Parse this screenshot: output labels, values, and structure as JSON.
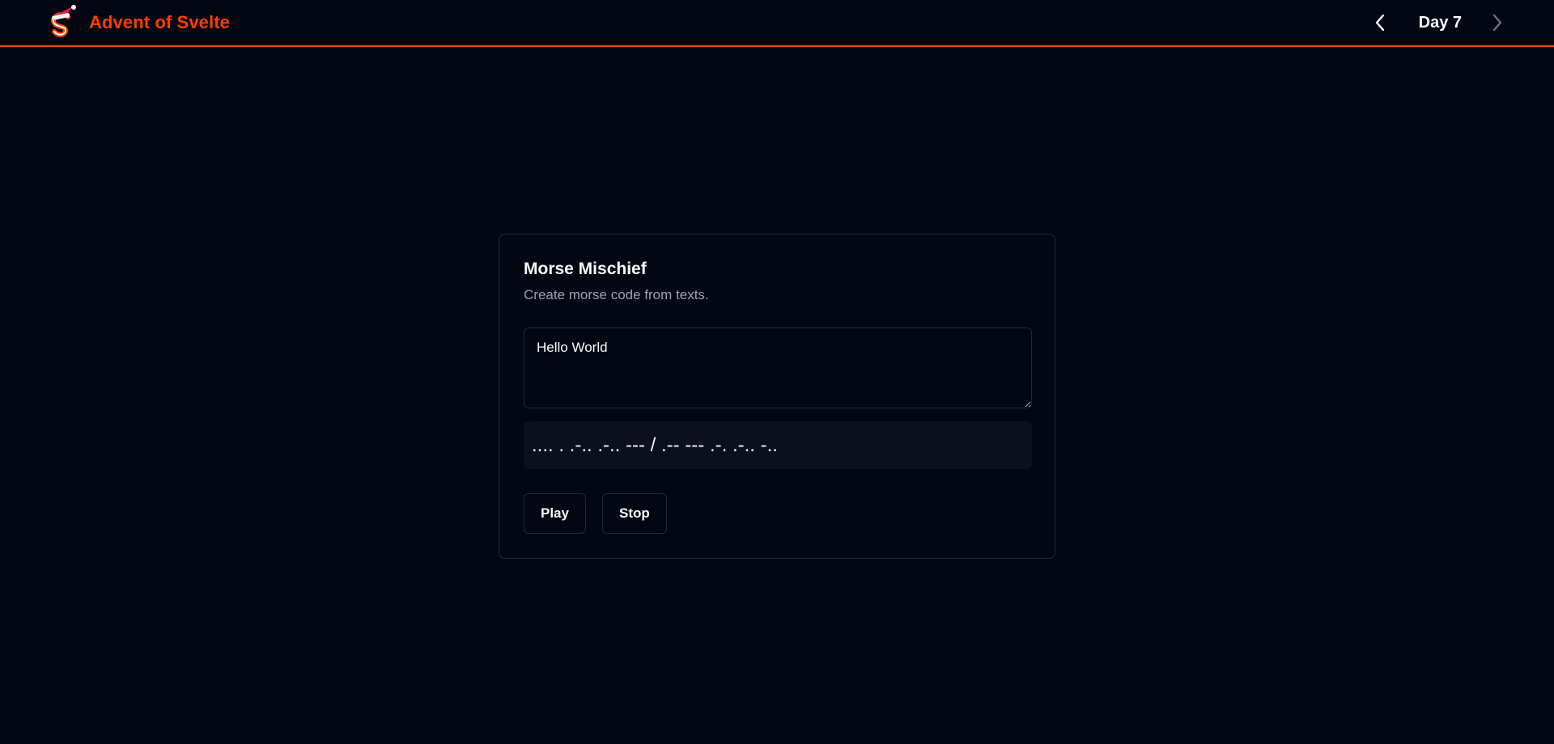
{
  "header": {
    "brand_title": "Advent of Svelte",
    "logo_icon": "svelte-santa-logo",
    "day_label": "Day 7",
    "prev_icon": "chevron-left-icon",
    "next_icon": "chevron-right-icon",
    "accent_color": "#ff3e00"
  },
  "card": {
    "title": "Morse Mischief",
    "description": "Create morse code from texts.",
    "input_value": "Hello World",
    "morse_output": ".... . .-.. .-.. --- / .-- --- .-. .-.. -..",
    "play_label": "Play",
    "stop_label": "Stop"
  }
}
